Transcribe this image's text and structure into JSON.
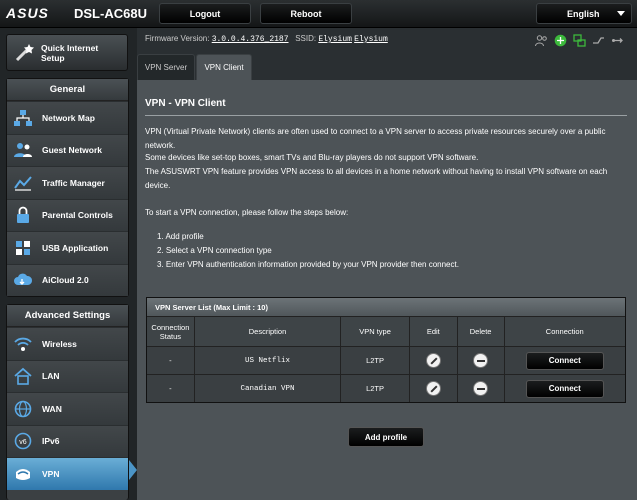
{
  "header": {
    "brand": "ASUS",
    "model": "DSL-AC68U",
    "logout_label": "Logout",
    "reboot_label": "Reboot",
    "language": "English"
  },
  "sidebar": {
    "quick_setup_label_1": "Quick Internet",
    "quick_setup_label_2": "Setup",
    "general_title": "General",
    "general_items": [
      {
        "label": "Network Map",
        "icon": "network-map-icon"
      },
      {
        "label": "Guest Network",
        "icon": "guest-network-icon"
      },
      {
        "label": "Traffic Manager",
        "icon": "traffic-manager-icon"
      },
      {
        "label": "Parental Controls",
        "icon": "parental-controls-icon"
      },
      {
        "label": "USB Application",
        "icon": "usb-icon"
      },
      {
        "label": "AiCloud 2.0",
        "icon": "cloud-icon"
      }
    ],
    "advanced_title": "Advanced Settings",
    "advanced_items": [
      {
        "label": "Wireless",
        "icon": "wireless-icon"
      },
      {
        "label": "LAN",
        "icon": "home-icon"
      },
      {
        "label": "WAN",
        "icon": "globe-icon"
      },
      {
        "label": "IPv6",
        "icon": "ipv6-icon"
      },
      {
        "label": "VPN",
        "icon": "vpn-icon",
        "active": true
      }
    ]
  },
  "status_bar": {
    "firmware_label": "Firmware Version:",
    "firmware_version": "3.0.0.4.376_2187",
    "ssid_label": "SSID:",
    "ssid_1": "Elysium",
    "ssid_2": "Elysium"
  },
  "tabs": [
    {
      "label": "VPN Server",
      "active": false
    },
    {
      "label": "VPN Client",
      "active": true
    }
  ],
  "page": {
    "title": "VPN - VPN Client",
    "desc1": "VPN (Virtual Private Network) clients are often used to connect to a VPN server to access private resources securely over a public network.",
    "desc2": "Some devices like set-top boxes, smart TVs and Blu-ray players do not support VPN software.",
    "desc3": "The ASUSWRT VPN feature provides VPN access to all devices in a home network without having to install VPN software on each device.",
    "steps_intro": "To start a VPN connection, please follow the steps below:",
    "steps": [
      "1.  Add profile",
      "2.  Select a VPN connection type",
      "3.  Enter VPN authentication information provided by your VPN provider then connect."
    ]
  },
  "vpn_table": {
    "caption": "VPN Server List (Max Limit : 10)",
    "headers": [
      "Connection Status",
      "Description",
      "VPN type",
      "Edit",
      "Delete",
      "Connection"
    ],
    "rows": [
      {
        "status": "-",
        "description": "US Netflix",
        "type": "L2TP",
        "connect_label": "Connect"
      },
      {
        "status": "-",
        "description": "Canadian VPN",
        "type": "L2TP",
        "connect_label": "Connect"
      }
    ]
  },
  "add_profile_label": "Add profile",
  "colors": {
    "accent": "#4b94c6",
    "panel": "#4d5357",
    "background": "#1a1d1f"
  }
}
